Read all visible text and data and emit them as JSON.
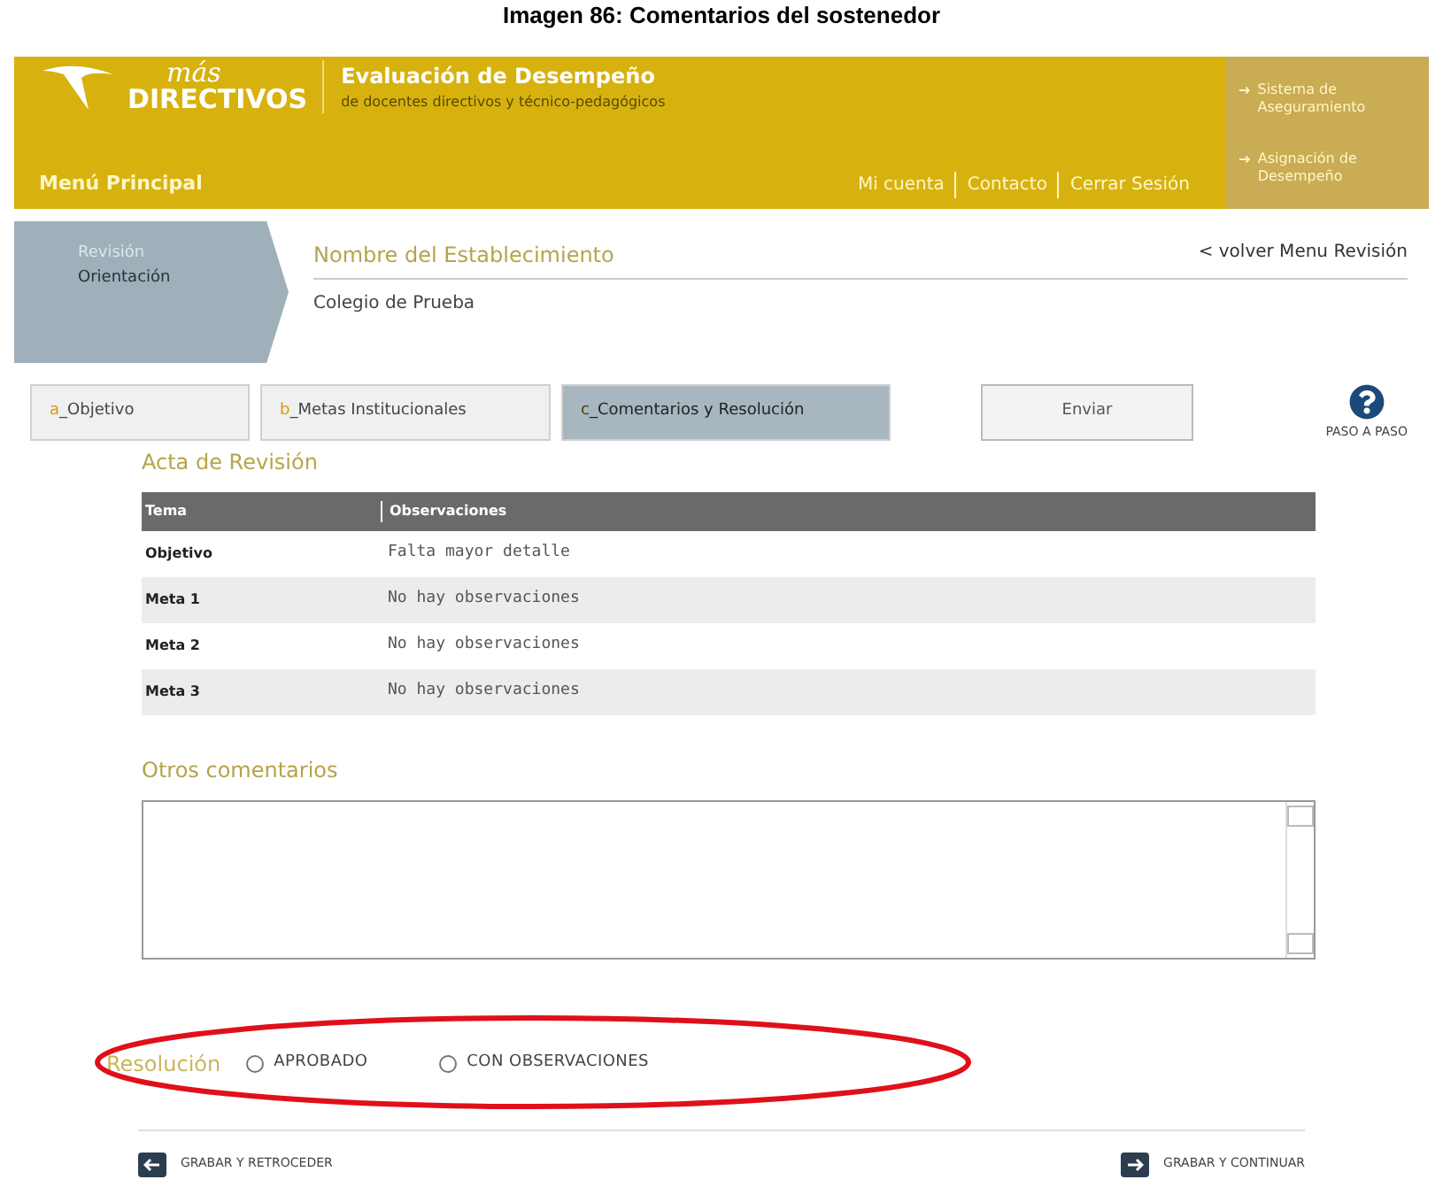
{
  "caption": "Imagen 86: Comentarios del sostenedor",
  "header": {
    "logo_small": "más",
    "logo_big": "DIRECTIVOS",
    "title": "Evaluación de Desempeño",
    "subtitle": "de docentes directivos y técnico-pedagógicos",
    "menu": "Menú Principal",
    "links": [
      "Mi cuenta",
      "Contacto",
      "Cerrar Sesión"
    ],
    "side_links": [
      "Sistema de Aseguramiento",
      "Asignación de Desempeño"
    ]
  },
  "breadcrumb": {
    "step": "Revisión",
    "current": "Orientación",
    "title": "Nombre del Establecimiento",
    "school": "Colegio de Prueba",
    "back": "< volver Menu Revisión"
  },
  "tabs": [
    {
      "letter": "a",
      "label": "_Objetivo",
      "selected": false
    },
    {
      "letter": "b",
      "label": "_Metas Institucionales",
      "selected": false
    },
    {
      "letter": "c",
      "label": "_Comentarios y Resolución",
      "selected": true
    }
  ],
  "send_button": "Enviar",
  "help": "PASO A PASO",
  "acta": {
    "title": "Acta de Revisión",
    "columns": [
      "Tema",
      "Observaciones"
    ],
    "rows": [
      [
        "Objetivo",
        "Falta mayor detalle"
      ],
      [
        "Meta 1",
        "No hay observaciones"
      ],
      [
        "Meta 2",
        "No hay observaciones"
      ],
      [
        "Meta 3",
        "No hay observaciones"
      ]
    ]
  },
  "comments": {
    "title": "Otros comentarios"
  },
  "resolution": {
    "label": "Resolución",
    "options": [
      {
        "label": "APROBADO",
        "selected": false
      },
      {
        "label": "CON OBSERVACIONES",
        "selected": false
      }
    ]
  },
  "footer": {
    "back": "GRABAR Y RETROCEDER",
    "next": "GRABAR Y CONTINUAR"
  }
}
